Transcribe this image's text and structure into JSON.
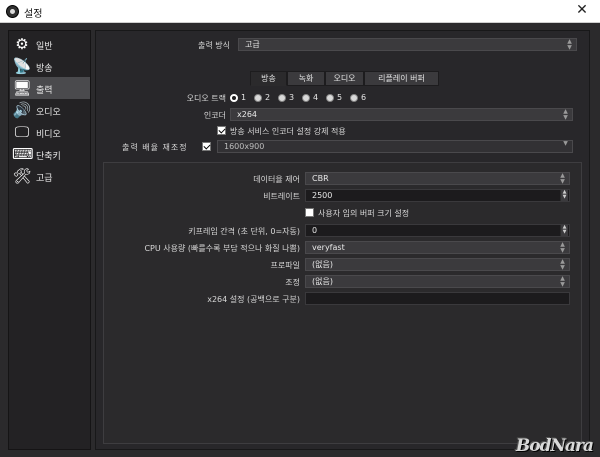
{
  "window": {
    "title": "설정",
    "close": "✕"
  },
  "sidebar": {
    "items": [
      {
        "label": "일반",
        "icon": "gear-icon",
        "glyph": "⚙"
      },
      {
        "label": "방송",
        "icon": "broadcast-antenna-icon",
        "glyph": "📡"
      },
      {
        "label": "출력",
        "icon": "output-monitor-icon",
        "glyph": "🖥"
      },
      {
        "label": "오디오",
        "icon": "speaker-icon",
        "glyph": "🔊"
      },
      {
        "label": "비디오",
        "icon": "monitor-icon",
        "glyph": "🖵"
      },
      {
        "label": "단축키",
        "icon": "keyboard-icon",
        "glyph": "⌨"
      },
      {
        "label": "고급",
        "icon": "tools-icon",
        "glyph": "🛠"
      }
    ],
    "active_index": 2
  },
  "output": {
    "mode_label": "출력 방식",
    "mode_value": "고급",
    "tabs": [
      "방송",
      "녹화",
      "오디오",
      "리플레이 버퍼"
    ],
    "active_tab": 0,
    "audio_track_label": "오디오 트랙",
    "audio_tracks": [
      "1",
      "2",
      "3",
      "4",
      "5",
      "6"
    ],
    "encoder_label": "인코더",
    "encoder_value": "x264",
    "enforce_label": "방송 서비스 인코더 설정 강제 적용",
    "rescale_label": "출력 배율 재조정",
    "rescale_value": "1600x900",
    "rate_control_label": "데이터율 제어",
    "rate_control_value": "CBR",
    "bitrate_label": "비트레이트",
    "bitrate_value": "2500",
    "custom_buffer_label": "사용자 임의 버퍼 크기 설정",
    "keyframe_label": "키프레임 간격 (초 단위, 0=자동)",
    "keyframe_value": "0",
    "cpu_label": "CPU 사용량 (빠를수록 부담 적으나 화질 나쁨)",
    "cpu_value": "veryfast",
    "profile_label": "프로파일",
    "profile_value": "(없음)",
    "tune_label": "조정",
    "tune_value": "(없음)",
    "x264opts_label": "x264 설정 (공백으로 구분)",
    "x264opts_value": ""
  },
  "watermark": "BodNara"
}
